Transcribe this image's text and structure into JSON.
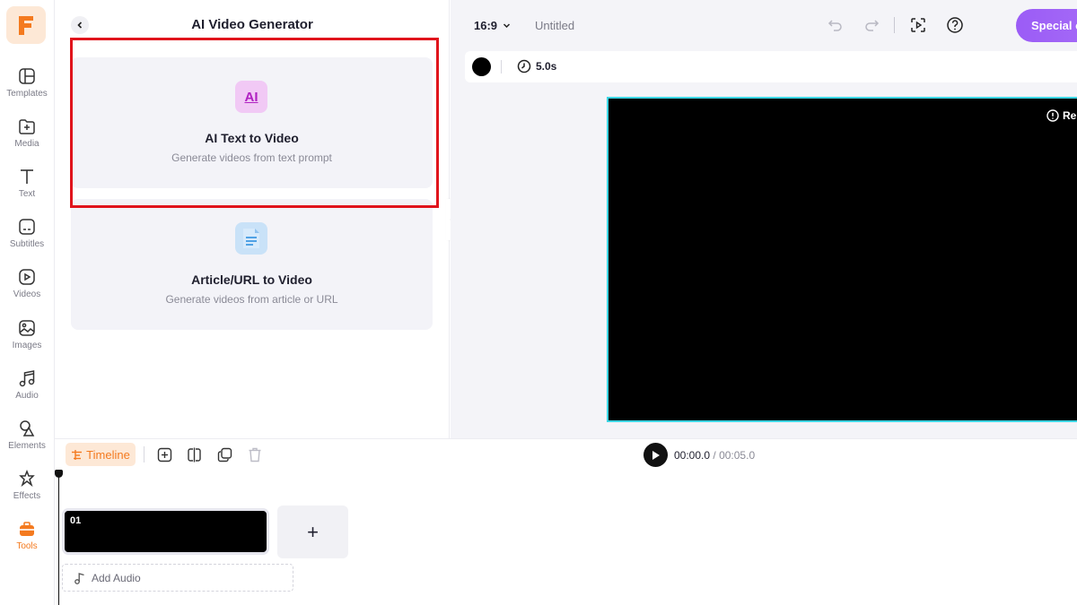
{
  "app": {
    "logo_letter": "F",
    "accent": "#f47a1f",
    "highlight_color": "#e0141c"
  },
  "rail": {
    "items": [
      {
        "label": "Templates",
        "icon": "templates-icon"
      },
      {
        "label": "Media",
        "icon": "media-icon"
      },
      {
        "label": "Text",
        "icon": "text-icon"
      },
      {
        "label": "Subtitles",
        "icon": "subtitles-icon"
      },
      {
        "label": "Videos",
        "icon": "videos-icon"
      },
      {
        "label": "Images",
        "icon": "images-icon"
      },
      {
        "label": "Audio",
        "icon": "audio-icon"
      },
      {
        "label": "Elements",
        "icon": "elements-icon"
      },
      {
        "label": "Effects",
        "icon": "effects-icon"
      },
      {
        "label": "Tools",
        "icon": "tools-icon",
        "active": true
      }
    ]
  },
  "panel": {
    "title": "AI Video Generator",
    "cards": [
      {
        "title": "AI Text to Video",
        "subtitle": "Generate videos from text prompt",
        "icon_text": "AI"
      },
      {
        "title": "Article/URL to Video",
        "subtitle": "Generate videos from article or URL",
        "icon": "document-icon"
      }
    ]
  },
  "toolbar": {
    "aspect_ratio": "16:9",
    "doc_title": "Untitled",
    "special_label": "Special offer"
  },
  "scene": {
    "background_color": "#000000",
    "duration": "5.0s",
    "canvas_badge": "Re"
  },
  "timeline": {
    "label": "Timeline",
    "current_time": "00:00.0",
    "separator": "/",
    "total_time": "00:05.0",
    "clip_number": "01",
    "add_clip_symbol": "+",
    "add_audio_label": "Add Audio"
  }
}
